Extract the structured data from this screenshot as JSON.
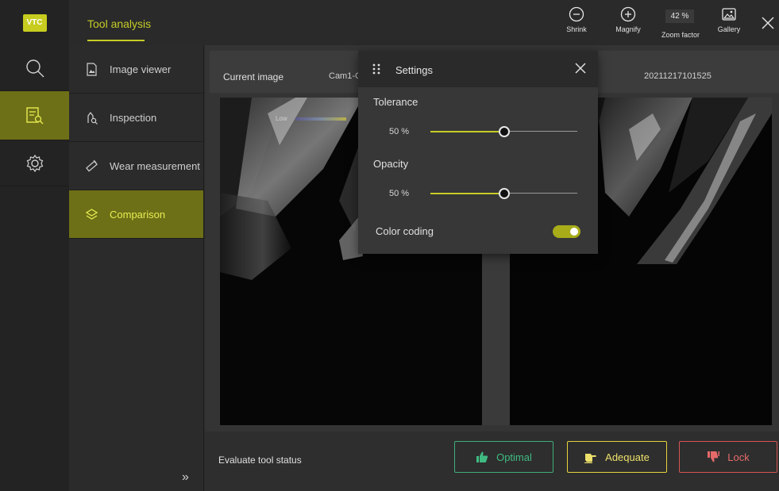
{
  "app": {
    "logo_text": "VTC",
    "title": "Tool analysis"
  },
  "toolbar": {
    "shrink_label": "Shrink",
    "magnify_label": "Magnify",
    "zoom_value": "42 %",
    "zoom_label": "Zoom factor",
    "gallery_label": "Gallery"
  },
  "rail": {
    "items": [
      {
        "icon": "search-icon"
      },
      {
        "icon": "tool-analysis-icon",
        "active": true
      },
      {
        "icon": "gear-icon"
      }
    ]
  },
  "menu": {
    "items": [
      {
        "label": "Image viewer",
        "icon": "image-file-icon"
      },
      {
        "label": "Inspection",
        "icon": "inspection-icon"
      },
      {
        "label": "Wear measurement",
        "icon": "ruler-icon"
      },
      {
        "label": "Comparison",
        "icon": "layers-icon",
        "active": true
      }
    ],
    "expand_glyph": "»"
  },
  "header": {
    "current_label": "Current image",
    "cam_label": "Cam1-C0",
    "date_label": "20211217101525"
  },
  "legend": {
    "low_label": "Low"
  },
  "footer": {
    "eval_label": "Evaluate tool status",
    "optimal_label": "Optimal",
    "adequate_label": "Adequate",
    "lock_label": "Lock"
  },
  "settings": {
    "title": "Settings",
    "tolerance_label": "Tolerance",
    "tolerance_value": "50 %",
    "tolerance_fraction": 0.5,
    "opacity_label": "Opacity",
    "opacity_value": "50 %",
    "opacity_fraction": 0.5,
    "color_coding_label": "Color coding",
    "color_coding_on": true
  },
  "colors": {
    "accent": "#c6cc27",
    "active_bg": "#6d7016",
    "optimal": "#3fae7a",
    "adequate": "#e6d33c",
    "lock": "#d85454"
  }
}
